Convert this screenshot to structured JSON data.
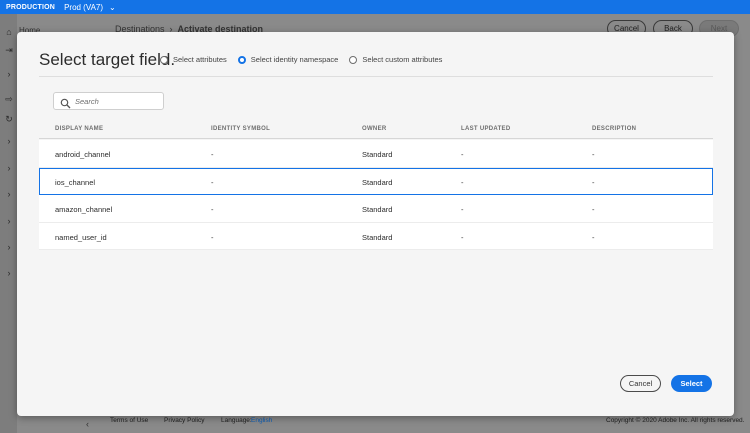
{
  "topbar": {
    "environment": "PRODUCTION",
    "org": "Prod (VA7)"
  },
  "sidebar": {
    "home_label": "Home"
  },
  "breadcrumb": {
    "parent": "Destinations",
    "current": "Activate destination"
  },
  "header_buttons": {
    "cancel": "Cancel",
    "back": "Back",
    "next": "Next"
  },
  "footer": {
    "terms": "Terms of Use",
    "privacy": "Privacy Policy",
    "language_label": "Language:",
    "language_value": "English",
    "copyright": "Copyright © 2020 Adobe Inc. All rights reserved."
  },
  "modal": {
    "title": "Select target field.",
    "radio_options": [
      {
        "label": "Select attributes",
        "selected": false
      },
      {
        "label": "Select identity namespace",
        "selected": true
      },
      {
        "label": "Select custom attributes",
        "selected": false
      }
    ],
    "search_placeholder": "Search",
    "columns": [
      "DISPLAY NAME",
      "IDENTITY SYMBOL",
      "OWNER",
      "LAST UPDATED",
      "DESCRIPTION"
    ],
    "rows": [
      {
        "display_name": "android_channel",
        "identity_symbol": "-",
        "owner": "Standard",
        "last_updated": "-",
        "description": "-"
      },
      {
        "display_name": "ios_channel",
        "identity_symbol": "-",
        "owner": "Standard",
        "last_updated": "-",
        "description": "-"
      },
      {
        "display_name": "amazon_channel",
        "identity_symbol": "-",
        "owner": "Standard",
        "last_updated": "-",
        "description": "-"
      },
      {
        "display_name": "named_user_id",
        "identity_symbol": "-",
        "owner": "Standard",
        "last_updated": "-",
        "description": "-"
      }
    ],
    "selected_row": "ios_channel",
    "cancel_label": "Cancel",
    "select_label": "Select"
  },
  "colors": {
    "accent": "#1473e6",
    "overlay": "#8a8a8a"
  }
}
